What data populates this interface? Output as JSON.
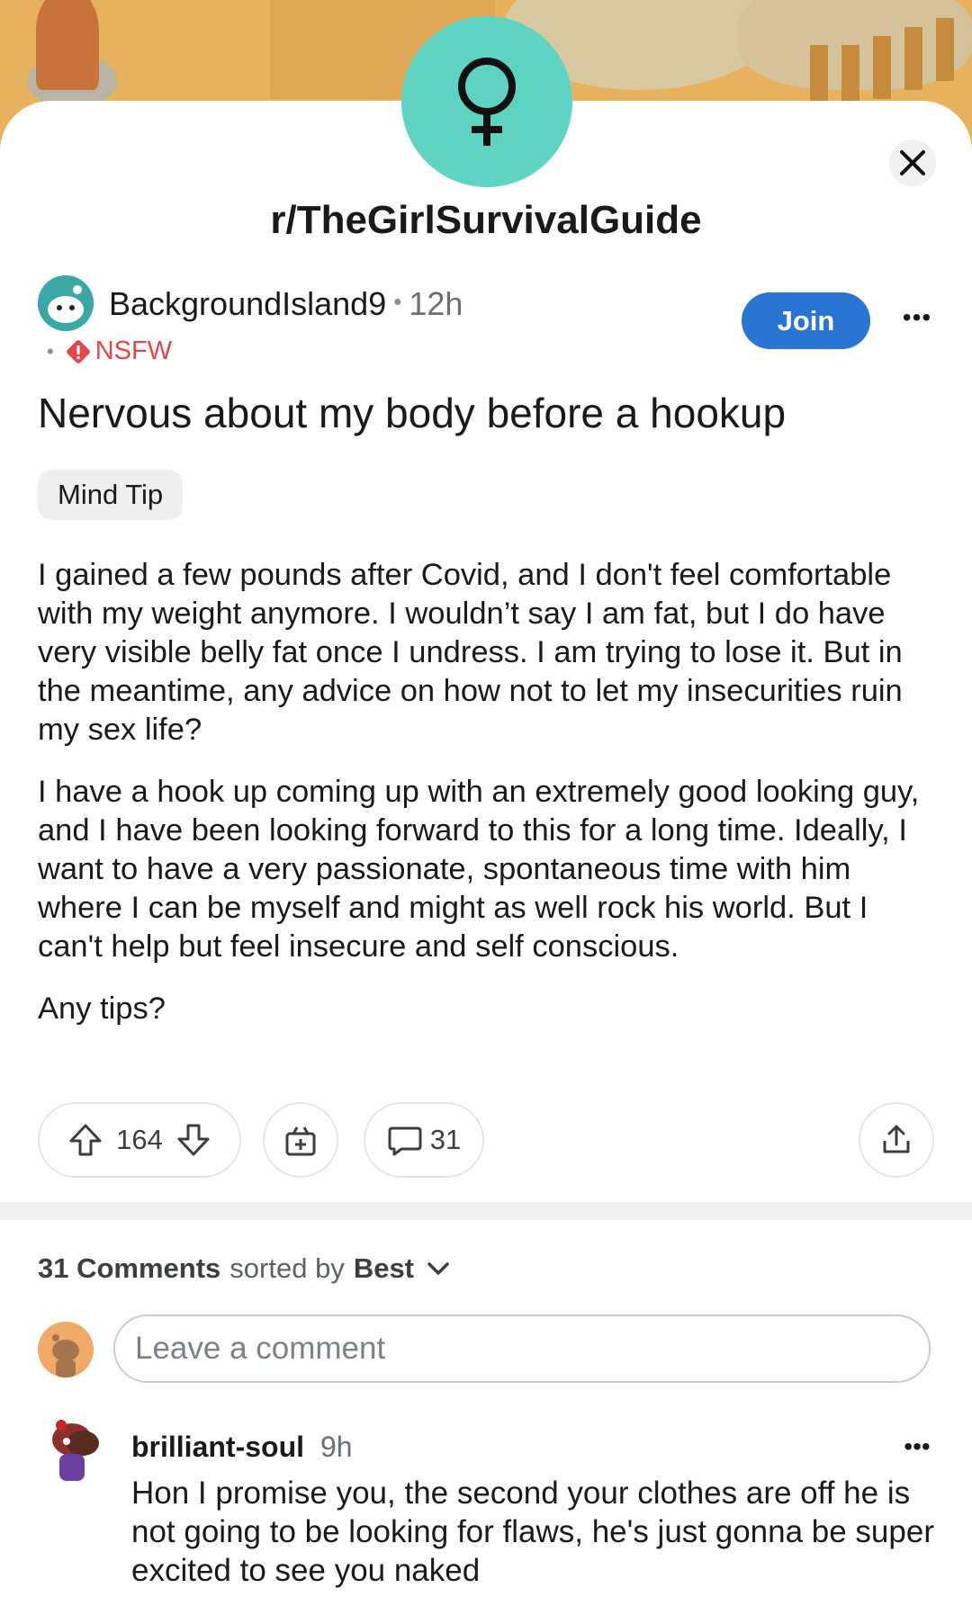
{
  "subreddit": {
    "name": "r/TheGirlSurvivalGuide",
    "icon": "female-symbol-icon",
    "accent_color": "#5fd3c2"
  },
  "post": {
    "author": "BackgroundIsland9",
    "time": "12h",
    "nsfw_label": "NSFW",
    "join_label": "Join",
    "title": "Nervous about my body before a hookup",
    "flair": "Mind Tip",
    "body": [
      "I gained a few pounds after Covid, and I don't feel comfortable with my weight anymore. I wouldn’t say I am fat, but I do have very visible belly fat once I undress. I am trying to lose it. But in the meantime, any advice on how not to let my insecurities ruin my sex life?",
      "I have a hook up coming up with an extremely good looking guy, and I have been looking forward to this for a long time. Ideally, I want to have a very passionate, spontaneous time with him where I can be myself and might as well rock his world. But I can't help but feel insecure and self conscious.",
      "Any tips?"
    ],
    "votes": "164",
    "comment_count": "31"
  },
  "comments_section": {
    "count_label": "31 Comments",
    "sorted_by_text": "sorted by",
    "sort_value": "Best",
    "input_placeholder": "Leave a comment"
  },
  "comments": [
    {
      "author": "brilliant-soul",
      "time": "9h",
      "text": "Hon I promise you, the second your clothes are off he is not going to be looking for flaws, he's just gonna be super excited to see you naked"
    }
  ],
  "colors": {
    "join_button": "#2a75d3",
    "nsfw": "#e0484b"
  }
}
